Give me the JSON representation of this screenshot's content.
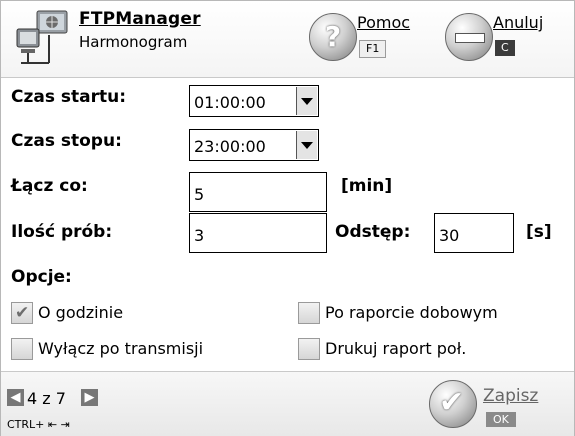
{
  "header": {
    "app_title": "FTPManager",
    "subtitle": "Harmonogram",
    "app_icon": "computer-network-icon",
    "help": {
      "label": "Pomoc",
      "key": "F1",
      "icon": "question-icon"
    },
    "cancel": {
      "label": "Anuluj",
      "key": "C",
      "icon": "minus-icon"
    }
  },
  "form": {
    "start_label": "Czas startu:",
    "start_value": "01:00:00",
    "stop_label": "Czas stopu:",
    "stop_value": "23:00:00",
    "interval_label": "Łącz co:",
    "interval_value": "5",
    "interval_unit": "[min]",
    "tries_label": "Ilość prób:",
    "tries_value": "3",
    "gap_label": "Odstęp:",
    "gap_value": "30",
    "gap_unit": "[s]",
    "options_label": "Opcje:"
  },
  "options": [
    {
      "label": "O godzinie",
      "checked": true
    },
    {
      "label": "Po raporcie dobowym",
      "checked": false
    },
    {
      "label": "Wyłącz po transmisji",
      "checked": false
    },
    {
      "label": "Drukuj raport poł.",
      "checked": false
    }
  ],
  "footer": {
    "pager": "4 z 7",
    "prev_icon": "arrow-left-icon",
    "next_icon": "arrow-right-icon",
    "shortcut": "CTRL+ ⇤ ⇥",
    "save": {
      "label": "Zapisz",
      "key": "OK",
      "icon": "checkmark-icon"
    }
  },
  "colors": {
    "border": "#b8b8b8",
    "field_border": "#000000",
    "checkbox_tick": "#6e6e6e"
  }
}
